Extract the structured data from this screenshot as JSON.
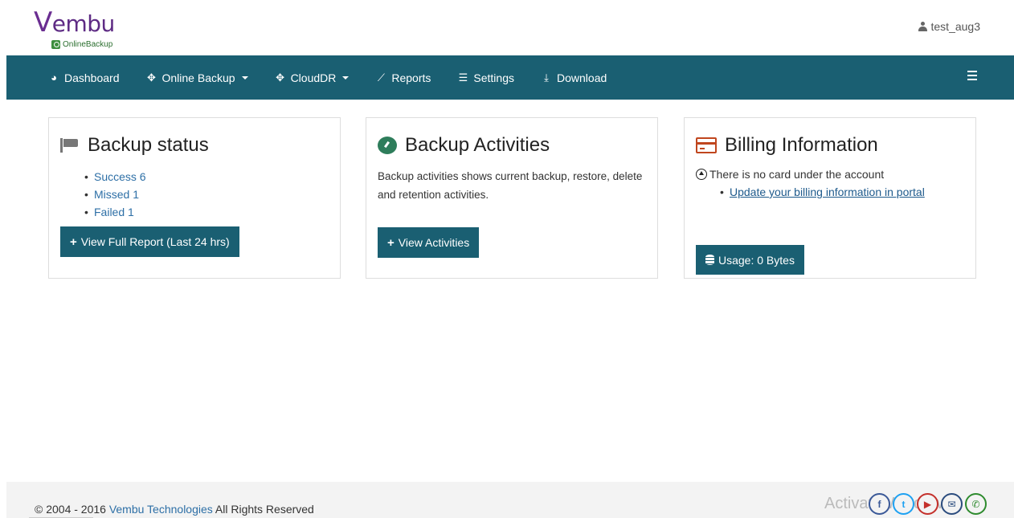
{
  "brand": {
    "logo_text_v": "V",
    "logo_text_rest": "embu",
    "logo_sub": "OnlineBackup"
  },
  "user": {
    "name": "test_aug3"
  },
  "nav": {
    "items": [
      {
        "label": "Dashboard",
        "icon": "dashboard-icon"
      },
      {
        "label": "Online Backup",
        "icon": "move-icon",
        "dropdown": true
      },
      {
        "label": "CloudDR",
        "icon": "move-icon",
        "dropdown": true
      },
      {
        "label": "Reports",
        "icon": "chart-icon"
      },
      {
        "label": "Settings",
        "icon": "sliders-icon"
      },
      {
        "label": "Download",
        "icon": "download-icon"
      }
    ]
  },
  "cards": {
    "backup_status": {
      "title": "Backup status",
      "items": [
        "Success 6",
        "Missed 1",
        "Failed 1"
      ],
      "button": "View Full Report (Last 24 hrs)"
    },
    "backup_activities": {
      "title": "Backup Activities",
      "description": "Backup activities shows current backup, restore, delete and retention activities.",
      "button": "View Activities"
    },
    "billing": {
      "title": "Billing Information",
      "notice": "There is no card under the account",
      "link": "Update your billing information in portal",
      "button": "Usage: 0 Bytes"
    }
  },
  "footer": {
    "copyright_prefix": "© 2004 - 2016 ",
    "company": "Vembu Technologies",
    "copyright_suffix": " All Rights Reserved",
    "activate_text": "Activate Windows"
  },
  "colors": {
    "navbar": "#1a5f72",
    "link": "#2d6fa6",
    "brand": "#5e2b84"
  }
}
